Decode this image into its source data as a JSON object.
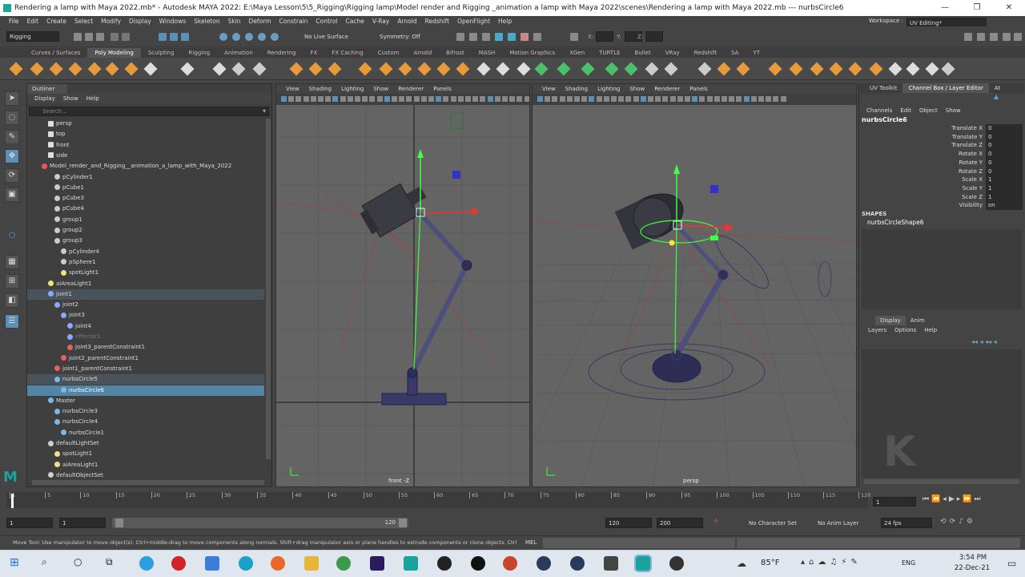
{
  "window": {
    "title": "Rendering a lamp with Maya 2022.mb* - Autodesk MAYA 2022: E:\\Maya Lesson\\5\\5_Rigging\\Rigging lamp\\Model render and Rigging _animation a lamp with Maya 2022\\scenes\\Rendering a lamp with Maya 2022.mb   ---   nurbsCircle6",
    "minimize": "—",
    "maximize": "❐",
    "close": "✕"
  },
  "menu": [
    "File",
    "Edit",
    "Create",
    "Select",
    "Modify",
    "Display",
    "Windows",
    "Skeleton",
    "Skin",
    "Deform",
    "Constrain",
    "Control",
    "Cache",
    "V-Ray",
    "Arnold",
    "Redshift",
    "OpenFlight",
    "Help"
  ],
  "workspace": {
    "label": "Workspace :",
    "value": "UV Editing*"
  },
  "statusline": {
    "mode": "Rigging",
    "live_surface": "No Live Surface",
    "symmetry": "Symmetry: Off",
    "x": "X:",
    "y": "Y:",
    "z": "Z:"
  },
  "shelf_tabs": [
    "Curves / Surfaces",
    "Poly Modeling",
    "Sculpting",
    "Rigging",
    "Animation",
    "Rendering",
    "FX",
    "FX Caching",
    "Custom",
    "Arnold",
    "Bifrost",
    "MASH",
    "Motion Graphics",
    "XGen",
    "TURTLE",
    "Bullet",
    "VRay",
    "Redshift",
    "SA",
    "YT"
  ],
  "shelf_active": "Poly Modeling",
  "outliner": {
    "tab": "Outliner",
    "menu": [
      "Display",
      "Show",
      "Help"
    ],
    "search_placeholder": "Search...",
    "rows": [
      {
        "label": "persp",
        "indent": 1,
        "icon": "camera"
      },
      {
        "label": "top",
        "indent": 1,
        "icon": "camera"
      },
      {
        "label": "front",
        "indent": 1,
        "icon": "camera"
      },
      {
        "label": "side",
        "indent": 1,
        "icon": "camera"
      },
      {
        "label": "Model_render_and_Rigging__animation_a_lamp_with_Maya_2022",
        "indent": 0,
        "icon": "group"
      },
      {
        "label": "pCylinder1",
        "indent": 2,
        "icon": "mesh"
      },
      {
        "label": "pCube1",
        "indent": 2,
        "icon": "mesh"
      },
      {
        "label": "pCube3",
        "indent": 2,
        "icon": "mesh"
      },
      {
        "label": "pCube4",
        "indent": 2,
        "icon": "mesh"
      },
      {
        "label": "group1",
        "indent": 2,
        "icon": "mesh"
      },
      {
        "label": "group2",
        "indent": 2,
        "icon": "mesh"
      },
      {
        "label": "group3",
        "indent": 2,
        "icon": "mesh"
      },
      {
        "label": "pCylinder4",
        "indent": 3,
        "icon": "mesh"
      },
      {
        "label": "pSphere1",
        "indent": 3,
        "icon": "mesh"
      },
      {
        "label": "spotLight1",
        "indent": 3,
        "icon": "light"
      },
      {
        "label": "aiAreaLight1",
        "indent": 1,
        "icon": "light"
      },
      {
        "label": "joint1",
        "indent": 1,
        "icon": "joint",
        "state": "hl"
      },
      {
        "label": "joint2",
        "indent": 2,
        "icon": "joint"
      },
      {
        "label": "joint3",
        "indent": 3,
        "icon": "joint"
      },
      {
        "label": "joint4",
        "indent": 4,
        "icon": "joint"
      },
      {
        "label": "effector1",
        "indent": 4,
        "icon": "joint",
        "dim": true
      },
      {
        "label": "joint3_parentConstraint1",
        "indent": 4,
        "icon": "constraint"
      },
      {
        "label": "joint2_parentConstraint1",
        "indent": 3,
        "icon": "constraint"
      },
      {
        "label": "joint1_parentConstraint1",
        "indent": 2,
        "icon": "constraint"
      },
      {
        "label": "nurbsCircle5",
        "indent": 2,
        "icon": "curve",
        "state": "hl"
      },
      {
        "label": "nurbsCircle6",
        "indent": 3,
        "icon": "curve",
        "state": "sel"
      },
      {
        "label": "Master",
        "indent": 1,
        "icon": "curve"
      },
      {
        "label": "nurbsCircle3",
        "indent": 2,
        "icon": "curve"
      },
      {
        "label": "nurbsCircle4",
        "indent": 2,
        "icon": "curve"
      },
      {
        "label": "nurbsCircle1",
        "indent": 3,
        "icon": "curve"
      },
      {
        "label": "defaultLightSet",
        "indent": 1,
        "icon": "set"
      },
      {
        "label": "spotLight1",
        "indent": 2,
        "icon": "light"
      },
      {
        "label": "aiAreaLight1",
        "indent": 2,
        "icon": "light"
      },
      {
        "label": "defaultObjectSet",
        "indent": 1,
        "icon": "set"
      }
    ]
  },
  "viewport_menu": [
    "View",
    "Shading",
    "Lighting",
    "Show",
    "Renderer",
    "Panels"
  ],
  "viewport_left": {
    "label": "front -Z"
  },
  "viewport_right": {
    "label": "persp"
  },
  "channelbox": {
    "tabs": [
      "UV Toolkit",
      "Channel Box / Layer Editor",
      "At"
    ],
    "menu": [
      "Channels",
      "Edit",
      "Object",
      "Show"
    ],
    "object": "nurbsCircle6",
    "attrs": [
      {
        "k": "Translate X",
        "v": "0"
      },
      {
        "k": "Translate Y",
        "v": "0"
      },
      {
        "k": "Translate Z",
        "v": "0"
      },
      {
        "k": "Rotate X",
        "v": "0"
      },
      {
        "k": "Rotate Y",
        "v": "0"
      },
      {
        "k": "Rotate Z",
        "v": "0"
      },
      {
        "k": "Scale X",
        "v": "1"
      },
      {
        "k": "Scale Y",
        "v": "1"
      },
      {
        "k": "Scale Z",
        "v": "1"
      },
      {
        "k": "Visibility",
        "v": "on"
      }
    ],
    "shapes_label": "SHAPES",
    "shape": "nurbsCircleShape6",
    "layer_tabs": [
      "Display",
      "Anim"
    ],
    "layer_menu": [
      "Layers",
      "Options",
      "Help"
    ]
  },
  "timeline": {
    "ticks": [
      "1",
      "5",
      "10",
      "15",
      "20",
      "25",
      "30",
      "35",
      "40",
      "45",
      "50",
      "55",
      "60",
      "65",
      "70",
      "75",
      "80",
      "85",
      "90",
      "95",
      "100",
      "105",
      "110",
      "115",
      "120"
    ],
    "current": "1"
  },
  "range": {
    "start": "1",
    "inner_start": "1",
    "inner_end": "120",
    "end": "120",
    "anim_end": "200",
    "char_set": "No Character Set",
    "anim_layer": "No Anim Layer",
    "fps": "24 fps"
  },
  "helpline": {
    "text": "Move Tool: Use manipulator to move object(s). Ctrl+middle-drag to move components along normals. Shift+drag manipulator axis or plane handles to extrude components or clone objects. Ctrl+Shift+drag to con",
    "mel": "MEL"
  },
  "taskbar": {
    "weather": "85°F",
    "lang": "ENG",
    "time": "3:54 PM",
    "date": "22-Dec-21"
  }
}
